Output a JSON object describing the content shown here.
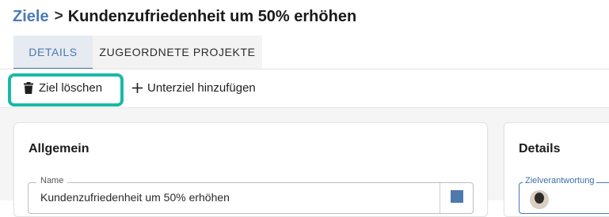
{
  "breadcrumb": {
    "parent": "Ziele",
    "separator": ">",
    "current": "Kundenzufriedenheit um 50% erhöhen"
  },
  "tabs": [
    {
      "label": "DETAILS",
      "active": true
    },
    {
      "label": "ZUGEORDNETE PROJEKTE",
      "active": false
    }
  ],
  "toolbar": {
    "delete_label": "Ziel löschen",
    "delete_icon": "trash-icon",
    "add_label": "Unterziel hinzufügen",
    "add_icon": "plus-icon"
  },
  "general": {
    "title": "Allgemein",
    "name_label": "Name",
    "name_value": "Kundenzufriedenheit um 50% erhöhen",
    "color": "#4f79ad"
  },
  "details": {
    "title": "Details",
    "responsible_label": "Zielverantwortung"
  },
  "colors": {
    "accent": "#4a78b0",
    "highlight": "#1ab9a8"
  }
}
